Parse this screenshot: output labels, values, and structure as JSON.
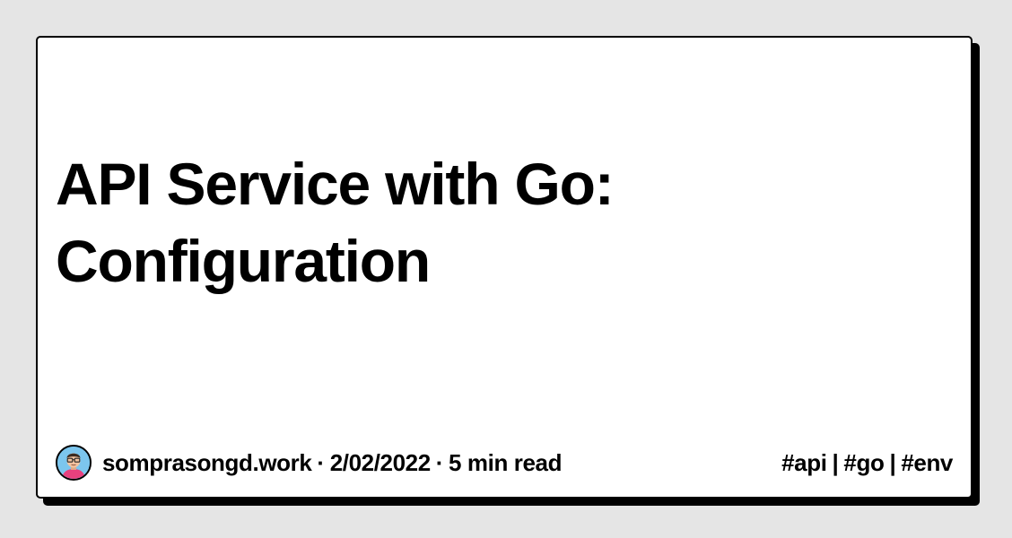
{
  "post": {
    "title": "API Service with Go: Configuration",
    "author": "somprasongd.work",
    "date": "2/02/2022",
    "read_time": "5 min read",
    "separator": "·"
  },
  "tags": {
    "items": [
      "#api",
      "#go",
      "#env"
    ],
    "separator": "|"
  },
  "avatar": {
    "icon": "avatar-cartoon-person-glasses"
  },
  "colors": {
    "background": "#e5e5e5",
    "card": "#ffffff",
    "text": "#000000"
  }
}
